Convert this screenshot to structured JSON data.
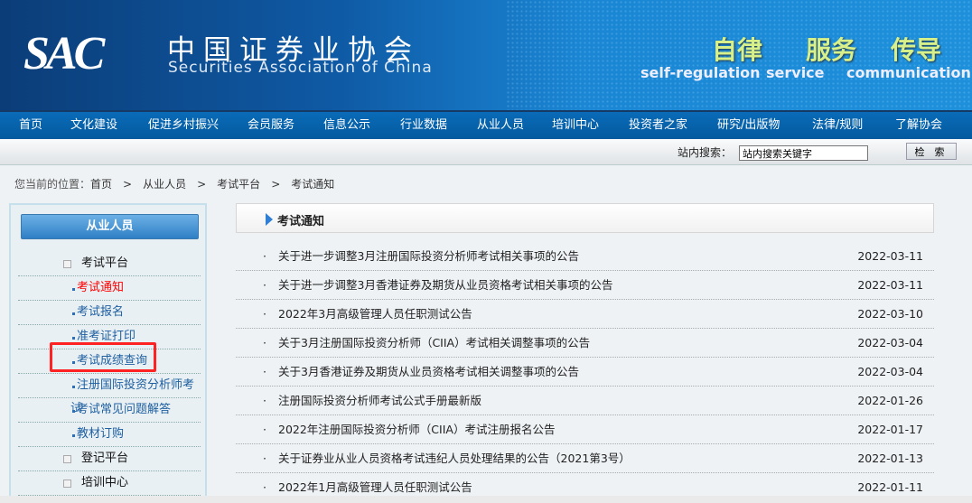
{
  "header": {
    "logo": "SAC",
    "title_cn": "中国证券业协会",
    "title_en": "Securities Association of China",
    "slogans": [
      {
        "cn": "自律",
        "en": "self-regulation"
      },
      {
        "cn": "服务",
        "en": "service"
      },
      {
        "cn": "传导",
        "en": "communication"
      }
    ]
  },
  "nav": [
    "首页",
    "文化建设",
    "促进乡村振兴",
    "会员服务",
    "信息公示",
    "行业数据",
    "从业人员",
    "培训中心",
    "投资者之家",
    "研究/出版物",
    "法律/规则",
    "了解协会"
  ],
  "search": {
    "label": "站内搜索：",
    "placeholder": "站内搜索关键字",
    "button": "检 索"
  },
  "breadcrumb": {
    "prefix": "您当前的位置：",
    "items": [
      "首页",
      "从业人员",
      "考试平台",
      "考试通知"
    ],
    "separator": ">"
  },
  "sidebar": {
    "title": "从业人员",
    "items": [
      {
        "label": "考试平台",
        "type": "group",
        "toggle": "⊟"
      },
      {
        "label": "考试通知",
        "type": "sub",
        "active": true
      },
      {
        "label": "考试报名",
        "type": "sub"
      },
      {
        "label": "准考证打印",
        "type": "sub"
      },
      {
        "label": "考试成绩查询",
        "type": "sub",
        "highlighted": true
      },
      {
        "label": "注册国际投资分析师考试",
        "type": "sub"
      },
      {
        "label": "考试常见问题解答",
        "type": "sub"
      },
      {
        "label": "教材订购",
        "type": "sub"
      },
      {
        "label": "登记平台",
        "type": "group",
        "toggle": "⊞"
      },
      {
        "label": "培训中心",
        "type": "group",
        "toggle": "⊟"
      }
    ]
  },
  "main": {
    "title": "考试通知",
    "bullet": "·",
    "items": [
      {
        "title": "关于进一步调整3月注册国际投资分析师考试相关事项的公告",
        "date": "2022-03-11"
      },
      {
        "title": "关于进一步调整3月香港证券及期货从业员资格考试相关事项的公告",
        "date": "2022-03-11"
      },
      {
        "title": "2022年3月高级管理人员任职测试公告",
        "date": "2022-03-10"
      },
      {
        "title": "关于3月注册国际投资分析师（CIIA）考试相关调整事项的公告",
        "date": "2022-03-04"
      },
      {
        "title": "关于3月香港证券及期货从业员资格考试相关调整事项的公告",
        "date": "2022-03-04"
      },
      {
        "title": "注册国际投资分析师考试公式手册最新版",
        "date": "2022-01-26"
      },
      {
        "title": "2022年注册国际投资分析师（CIIA）考试注册报名公告",
        "date": "2022-01-17"
      },
      {
        "title": "关于证券业从业人员资格考试违纪人员处理结果的公告（2021第3号）",
        "date": "2022-01-13"
      },
      {
        "title": "2022年1月高级管理人员任职测试公告",
        "date": "2022-01-11"
      }
    ]
  },
  "colors": {
    "nav": "#0a64ac",
    "active": "#ff0000",
    "link": "#1f5fa0",
    "highlight": "#ff2222"
  }
}
